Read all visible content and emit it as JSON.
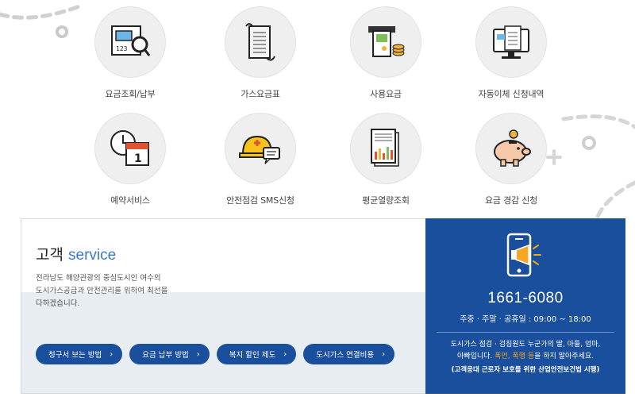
{
  "services": [
    {
      "label": "요금조회/납부",
      "icon": "bill-search-icon"
    },
    {
      "label": "가스요금표",
      "icon": "rate-sheet-icon"
    },
    {
      "label": "사용요금",
      "icon": "card-payment-icon"
    },
    {
      "label": "자동이체 신청내역",
      "icon": "monitor-document-icon"
    },
    {
      "label": "예약서비스",
      "icon": "clock-calendar-icon"
    },
    {
      "label": "안전점검 SMS신청",
      "icon": "helmet-message-icon"
    },
    {
      "label": "평균열량조회",
      "icon": "bar-report-icon"
    },
    {
      "label": "요금 경감 신청",
      "icon": "piggy-bank-icon"
    }
  ],
  "customer": {
    "title_main": "고객",
    "title_accent": "service",
    "desc_lines": [
      "전라남도 해양관광의 중심도시인 여수의",
      "도시가스공급과 안전관리를 위하여 최선을",
      "다하겠습니다."
    ],
    "buttons": [
      {
        "label": "청구서 보는 방법",
        "chevron": "›"
      },
      {
        "label": "요금 납부 방법",
        "chevron": "›"
      },
      {
        "label": "복지 할인 제도",
        "chevron": "›"
      },
      {
        "label": "도시가스 연결비용",
        "chevron": "›"
      }
    ]
  },
  "contact": {
    "phone": "1661-6080",
    "hours": "주중 · 주말 · 공휴일 : 09:00 ~ 18:00",
    "note_line1": "도시가스 점검 · 검침원도 누군가의 딸, 아들, 엄마,",
    "note_line2_pre": "아빠입니다.",
    "note_line2_hl": "폭언, 폭행 등",
    "note_line2_post": "을 하지 말아주세요.",
    "note_line3": "(고객응대 근로자 보호를 위한 산업안전보건법 시행)"
  },
  "colors": {
    "brand_blue": "#1a4f9d",
    "accent_blue": "#3a78c9",
    "highlight": "#f5a623",
    "circle_bg": "#efefef"
  }
}
